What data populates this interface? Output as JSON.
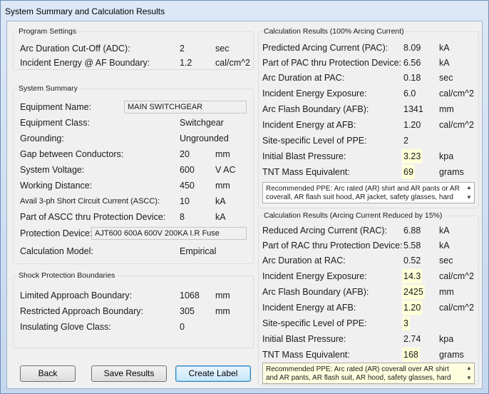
{
  "window": {
    "title": "System Summary and Calculation Results"
  },
  "program_settings": {
    "legend": "Program Settings",
    "rows": [
      {
        "label": "Arc Duration Cut-Off (ADC):",
        "value": "2",
        "unit": "sec"
      },
      {
        "label": "Incident Energy @ AF Boundary:",
        "value": "1.2",
        "unit": "cal/cm^2"
      }
    ]
  },
  "system_summary": {
    "legend": "System Summary",
    "equipment_name_label": "Equipment Name:",
    "equipment_name_value": "MAIN SWITCHGEAR",
    "equipment_class_label": "Equipment Class:",
    "equipment_class_value": "Switchgear",
    "grounding_label": "Grounding:",
    "grounding_value": "Ungrounded",
    "gap_label": "Gap between Conductors:",
    "gap_value": "20",
    "gap_unit": "mm",
    "voltage_label": "System Voltage:",
    "voltage_value": "600",
    "voltage_unit": "V AC",
    "working_label": "Working Distance:",
    "working_value": "450",
    "working_unit": "mm",
    "ascc_label": "Avail 3-ph Short Circuit Current (ASCC):",
    "ascc_value": "10",
    "ascc_unit": "kA",
    "part_ascc_label": "Part of ASCC thru Protection Device:",
    "part_ascc_value": "8",
    "part_ascc_unit": "kA",
    "protection_label": "Protection Device:",
    "protection_value": "AJT600 600A 600V 200KA I.R Fuse",
    "model_label": "Calculation Model:",
    "model_value": "Empirical"
  },
  "shock": {
    "legend": "Shock Protection Boundaries",
    "rows": [
      {
        "label": "Limited Approach Boundary:",
        "value": "1068",
        "unit": "mm"
      },
      {
        "label": "Restricted Approach Boundary:",
        "value": "305",
        "unit": "mm"
      },
      {
        "label": "Insulating Glove Class:",
        "value": "0",
        "unit": ""
      }
    ]
  },
  "results100": {
    "legend": "Calculation Results (100% Arcing Current)",
    "rows": [
      {
        "label": "Predicted Arcing Current (PAC):",
        "value": "8.09",
        "unit": "kA"
      },
      {
        "label": "Part of PAC thru Protection Device:",
        "value": "6.56",
        "unit": "kA"
      },
      {
        "label": "Arc Duration at PAC:",
        "value": "0.18",
        "unit": "sec"
      },
      {
        "label": "Incident Energy Exposure:",
        "value": "6.0",
        "unit": "cal/cm^2"
      },
      {
        "label": "Arc Flash Boundary (AFB):",
        "value": "1341",
        "unit": "mm"
      },
      {
        "label": "Incident Energy at AFB:",
        "value": "1.20",
        "unit": "cal/cm^2"
      },
      {
        "label": "Site-specific Level of PPE:",
        "value": "2",
        "unit": ""
      },
      {
        "label": "Initial Blast Pressure:",
        "value": "3.23",
        "unit": "kpa"
      },
      {
        "label": "TNT Mass Equivalent:",
        "value": "69",
        "unit": "grams"
      }
    ],
    "ppe_text": "Recommended PPE: Arc rated (AR) shirt and AR pants or AR coverall, AR flash suit hood, AR jacket, safety glasses, hard"
  },
  "results85": {
    "legend": "Calculation Results (Arcing Current Reduced by 15%)",
    "rows": [
      {
        "label": "Reduced Arcing Current (RAC):",
        "value": "6.88",
        "unit": "kA"
      },
      {
        "label": "Part of RAC thru Protection Device:",
        "value": "5.58",
        "unit": "kA"
      },
      {
        "label": "Arc Duration at RAC:",
        "value": "0.52",
        "unit": "sec"
      },
      {
        "label": "Incident Energy Exposure:",
        "value": "14.3",
        "unit": "cal/cm^2"
      },
      {
        "label": "Arc Flash Boundary (AFB):",
        "value": "2425",
        "unit": "mm"
      },
      {
        "label": "Incident Energy at AFB:",
        "value": "1.20",
        "unit": "cal/cm^2"
      },
      {
        "label": "Site-specific Level of PPE:",
        "value": "3",
        "unit": ""
      },
      {
        "label": "Initial Blast Pressure:",
        "value": "2.74",
        "unit": "kpa"
      },
      {
        "label": "TNT Mass Equivalent:",
        "value": "168",
        "unit": "grams"
      }
    ],
    "ppe_text": "Recommended PPE: Arc rated (AR) coverall over AR shirt and AR pants, AR flash suit, AR hood, safety glasses, hard hat, ear"
  },
  "buttons": {
    "back": "Back",
    "save": "Save Results",
    "label": "Create Label"
  },
  "icons": {
    "scroll_up": "▲",
    "scroll_down": "▼"
  },
  "colors": {
    "highlight": "#ffffd8",
    "title_bar": "#dce8f6"
  }
}
